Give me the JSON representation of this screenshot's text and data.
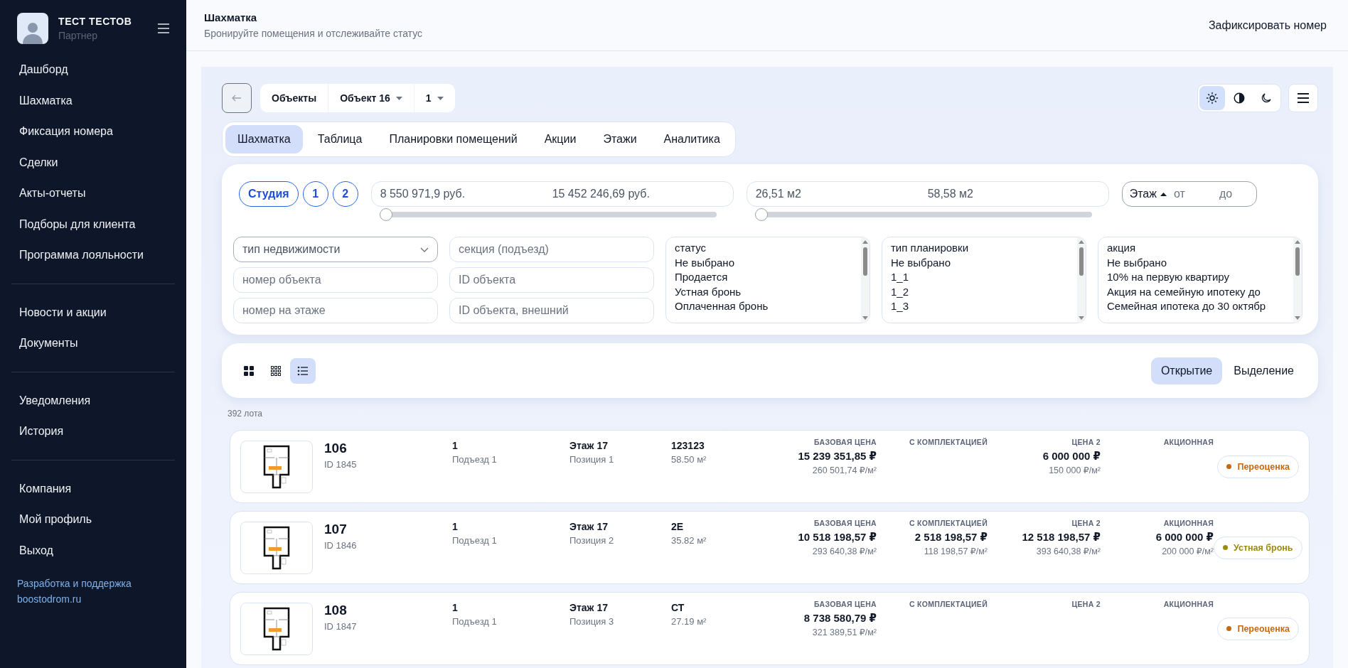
{
  "sidebar": {
    "user": {
      "name": "ТЕСТ ТЕСТОВ",
      "role": "Партнер"
    },
    "groups": [
      [
        {
          "label": "Дашборд"
        },
        {
          "label": "Шахматка"
        },
        {
          "label": "Фиксация номера"
        },
        {
          "label": "Сделки"
        },
        {
          "label": "Акты-отчеты"
        },
        {
          "label": "Подборы для клиента"
        },
        {
          "label": "Программа лояльности"
        }
      ],
      [
        {
          "label": "Новости и акции"
        },
        {
          "label": "Документы"
        }
      ],
      [
        {
          "label": "Уведомления"
        },
        {
          "label": "История"
        }
      ],
      [
        {
          "label": "Компания"
        },
        {
          "label": "Мой профиль"
        },
        {
          "label": "Выход"
        }
      ]
    ],
    "footer": {
      "text": "Разработка и поддержка",
      "link": "boostodrom.ru"
    }
  },
  "header": {
    "title": "Шахматка",
    "subtitle": "Бронируйте помещения и отслеживайте статус",
    "action": "Зафиксировать номер"
  },
  "toolbar": {
    "breadcrumbs": [
      {
        "label": "Объекты",
        "dropdown": false
      },
      {
        "label": "Объект 16",
        "dropdown": true
      },
      {
        "label": "1",
        "dropdown": true
      }
    ],
    "theme_modes": [
      {
        "kind": "light",
        "selected": true
      },
      {
        "kind": "contrast",
        "selected": false
      },
      {
        "kind": "dark",
        "selected": false
      }
    ]
  },
  "tabs": [
    {
      "label": "Шахматка",
      "selected": true
    },
    {
      "label": "Таблица",
      "selected": false
    },
    {
      "label": "Планировки помещений",
      "selected": false
    },
    {
      "label": "Акции",
      "selected": false
    },
    {
      "label": "Этажи",
      "selected": false
    },
    {
      "label": "Аналитика",
      "selected": false
    }
  ],
  "filters": {
    "rooms": [
      {
        "label": "Студия"
      },
      {
        "label": "1"
      },
      {
        "label": "2"
      }
    ],
    "price": {
      "min": "8 550 971,9 руб.",
      "max": "15 452 246,69 руб.",
      "level": 0
    },
    "area": {
      "min": "26,51 м2",
      "max": "58,58 м2",
      "level": 0
    },
    "floor": {
      "label": "Этаж",
      "from": {
        "placeholder": "от"
      },
      "to": {
        "placeholder": "до"
      }
    },
    "fields": [
      {
        "placeholder": "тип недвижимости",
        "kind": "select"
      },
      {
        "placeholder": "номер объекта",
        "kind": "text"
      },
      {
        "placeholder": "номер на этаже",
        "kind": "text"
      },
      {
        "placeholder": "секция (подъезд)",
        "kind": "text"
      },
      {
        "placeholder": "ID объекта",
        "kind": "text"
      },
      {
        "placeholder": "ID объекта, внешний",
        "kind": "text"
      }
    ],
    "lists": [
      {
        "items": [
          "статус",
          "Не выбрано",
          "Продается",
          "Устная бронь",
          "Оплаченная бронь"
        ]
      },
      {
        "items": [
          "тип планировки",
          "Не выбрано",
          "1_1",
          "1_2",
          "1_3"
        ]
      },
      {
        "items": [
          "акция",
          "Не выбрано",
          "10% на первую квартиру",
          "Акция на семейную ипотеку до",
          "Семейная ипотека до 30 октябр"
        ]
      }
    ]
  },
  "view_modes": [
    {
      "kind": "large-grid",
      "selected": false
    },
    {
      "kind": "small-grid",
      "selected": false
    },
    {
      "kind": "list",
      "selected": true
    }
  ],
  "click_modes": [
    {
      "label": "Открытие",
      "selected": true
    },
    {
      "label": "Выделение",
      "selected": false
    }
  ],
  "lot_count": "392 лота",
  "lots": [
    {
      "number": "106",
      "id": "ID 1845",
      "section": "1",
      "entrance": "Подъезд 1",
      "floor": "Этаж 17",
      "position": "Позиция 1",
      "layout": "123123",
      "area": "58.50 м²",
      "prices": [
        {
          "label": "БАЗОВАЯ ЦЕНА",
          "price": "15 239 351,85 ₽",
          "per_m2": "260 501,74 ₽/м²"
        },
        {
          "label": "С КОМПЛЕКТАЦИЕЙ"
        },
        {
          "label": "ЦЕНА 2",
          "price": "6 000 000 ₽",
          "per_m2": "150 000 ₽/м²"
        },
        {
          "label": "АКЦИОННАЯ"
        }
      ],
      "status": {
        "label": "Переоценка",
        "color": "#c8690f"
      }
    },
    {
      "number": "107",
      "id": "ID 1846",
      "section": "1",
      "entrance": "Подъезд 1",
      "floor": "Этаж 17",
      "position": "Позиция 2",
      "layout": "2Е",
      "area": "35.82 м²",
      "prices": [
        {
          "label": "БАЗОВАЯ ЦЕНА",
          "price": "10 518 198,57 ₽",
          "per_m2": "293 640,38 ₽/м²"
        },
        {
          "label": "С КОМПЛЕКТАЦИЕЙ",
          "price": "2 518 198,57 ₽",
          "per_m2": "118 198,57 ₽/м²"
        },
        {
          "label": "ЦЕНА 2",
          "price": "12 518 198,57 ₽",
          "per_m2": "393 640,38 ₽/м²"
        },
        {
          "label": "АКЦИОННАЯ",
          "price": "6 000 000 ₽",
          "per_m2": "200 000 ₽/м²"
        }
      ],
      "status": {
        "label": "Устная бронь",
        "color": "#9a8c10"
      }
    },
    {
      "number": "108",
      "id": "ID 1847",
      "section": "1",
      "entrance": "Подъезд 1",
      "floor": "Этаж 17",
      "position": "Позиция 3",
      "layout": "СТ",
      "area": "27.19 м²",
      "prices": [
        {
          "label": "БАЗОВАЯ ЦЕНА",
          "price": "8 738 580,79 ₽",
          "per_m2": "321 389,51 ₽/м²"
        },
        {
          "label": "С КОМПЛЕКТАЦИЕЙ"
        },
        {
          "label": "ЦЕНА 2"
        },
        {
          "label": "АКЦИОННАЯ"
        }
      ],
      "status": {
        "label": "Переоценка",
        "color": "#c8690f"
      }
    }
  ]
}
